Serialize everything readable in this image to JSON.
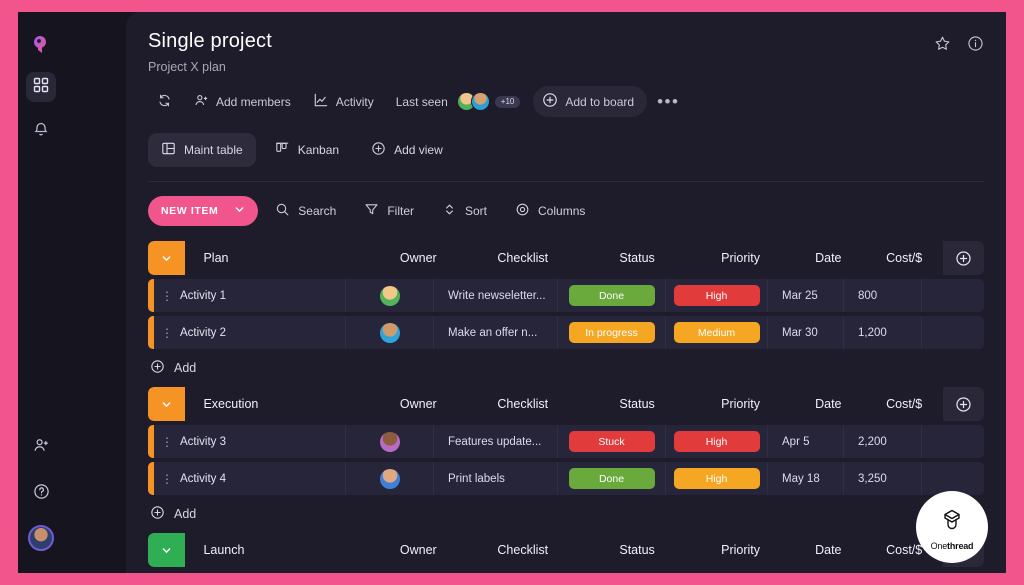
{
  "brand": {
    "accent_pink": "#f0568c",
    "frame_pink": "#f2548c",
    "panel_bg": "#1e1c2b",
    "row_bg": "#272539"
  },
  "rail": {
    "logo_icon": "onethread-logo-icon",
    "items": [
      {
        "name": "dashboard-grid-icon",
        "active": true
      },
      {
        "name": "notifications-bell-icon",
        "active": false
      }
    ],
    "bottom": [
      {
        "name": "add-person-icon"
      },
      {
        "name": "help-question-icon"
      },
      {
        "name": "user-avatar"
      }
    ]
  },
  "header": {
    "title": "Single project",
    "subtitle": "Project X plan",
    "star_icon": "star-icon",
    "info_icon": "info-icon"
  },
  "meta": {
    "refresh_icon": "refresh-icon",
    "add_members": "Add members",
    "activity": "Activity",
    "last_seen": "Last seen",
    "last_seen_more": "+10",
    "add_to_board": "Add to board",
    "more_icon": "more-dots-icon"
  },
  "views": [
    {
      "label": "Maint table",
      "icon": "table-view-icon",
      "active": true
    },
    {
      "label": "Kanban",
      "icon": "kanban-view-icon",
      "active": false
    },
    {
      "label": "Add view",
      "icon": "plus-circle-icon",
      "active": false
    }
  ],
  "actions": {
    "new_item": "NEW ITEM",
    "new_item_caret": "chevron-down-icon",
    "items": [
      {
        "label": "Search",
        "icon": "search-icon"
      },
      {
        "label": "Filter",
        "icon": "filter-icon"
      },
      {
        "label": "Sort",
        "icon": "sort-icon"
      },
      {
        "label": "Columns",
        "icon": "columns-eye-icon"
      }
    ]
  },
  "columns": [
    "Owner",
    "Checklist",
    "Status",
    "Priority",
    "Date",
    "Cost/$"
  ],
  "add_label": "Add",
  "groups": [
    {
      "name": "Plan",
      "color": "#f59425",
      "rows": [
        {
          "task": "Activity 1",
          "owner": "avatar-blonde",
          "checklist": "Write newseletter...",
          "status": {
            "label": "Done",
            "color": "#6aaa3c"
          },
          "priority": {
            "label": "High",
            "color": "#e13b3b"
          },
          "date": "Mar 25",
          "cost": "800"
        },
        {
          "task": "Activity 2",
          "owner": "avatar-teal",
          "checklist": "Make an offer n...",
          "status": {
            "label": "In progress",
            "color": "#f5a623"
          },
          "priority": {
            "label": "Medium",
            "color": "#f5a623"
          },
          "date": "Mar 30",
          "cost": "1,200"
        }
      ]
    },
    {
      "name": "Execution",
      "color": "#f59425",
      "rows": [
        {
          "task": "Activity 3",
          "owner": "avatar-purple",
          "checklist": "Features update...",
          "status": {
            "label": "Stuck",
            "color": "#e13b3b"
          },
          "priority": {
            "label": "High",
            "color": "#e13b3b"
          },
          "date": "Apr 5",
          "cost": "2,200"
        },
        {
          "task": "Activity 4",
          "owner": "avatar-blue",
          "checklist": "Print labels",
          "status": {
            "label": "Done",
            "color": "#6aaa3c"
          },
          "priority": {
            "label": "High",
            "color": "#f5a623"
          },
          "date": "May 18",
          "cost": "3,250"
        }
      ]
    },
    {
      "name": "Launch",
      "color": "#2fae54",
      "rows": []
    }
  ],
  "watermark": {
    "prefix": "One",
    "suffix": "thread",
    "icon": "onethread-mark-icon"
  }
}
